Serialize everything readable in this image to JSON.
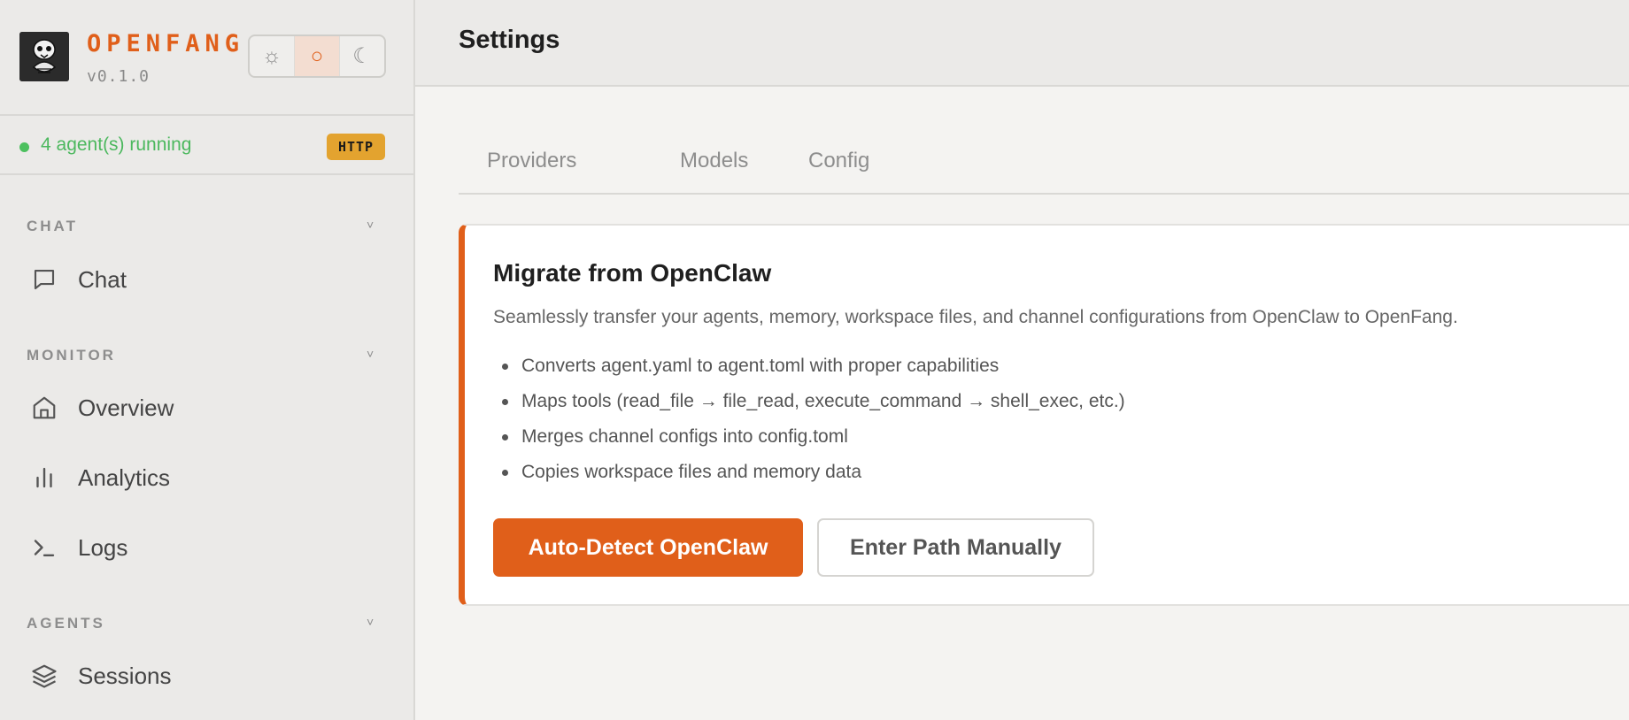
{
  "brand": {
    "name": "OPENFANG",
    "version": "v0.1.0",
    "color": "#e05f1a"
  },
  "theme_toggle": {
    "options": [
      {
        "icon": "sun-icon",
        "glyph": "☼",
        "active": false
      },
      {
        "icon": "circle-icon",
        "glyph": "○",
        "active": true
      },
      {
        "icon": "moon-icon",
        "glyph": "☾",
        "active": false
      }
    ]
  },
  "status": {
    "text": "4 agent(s) running",
    "badge": "HTTP",
    "dot_color": "#4cc05e"
  },
  "sidebar": {
    "sections": [
      {
        "label": "CHAT",
        "items": [
          {
            "label": "Chat",
            "icon": "chat-bubble-icon"
          }
        ]
      },
      {
        "label": "MONITOR",
        "items": [
          {
            "label": "Overview",
            "icon": "home-icon"
          },
          {
            "label": "Analytics",
            "icon": "bar-chart-icon"
          },
          {
            "label": "Logs",
            "icon": "terminal-icon"
          }
        ]
      },
      {
        "label": "AGENTS",
        "items": [
          {
            "label": "Sessions",
            "icon": "layers-icon"
          }
        ]
      }
    ],
    "chevron": "˅"
  },
  "header": {
    "title": "Settings"
  },
  "tabs": [
    "Providers",
    "Models",
    "Config"
  ],
  "migrate_card": {
    "title": "Migrate from OpenClaw",
    "description": "Seamlessly transfer your agents, memory, workspace files, and channel configurations from OpenClaw to OpenFang.",
    "bullets": [
      "Converts agent.yaml to agent.toml with proper capabilities",
      "Maps tools (read_file → file_read, execute_command → shell_exec, etc.)",
      "Merges channel configs into config.toml",
      "Copies workspace files and memory data"
    ],
    "primary_button": "Auto-Detect OpenClaw",
    "secondary_button": "Enter Path Manually",
    "accent_color": "#e05f1a"
  }
}
